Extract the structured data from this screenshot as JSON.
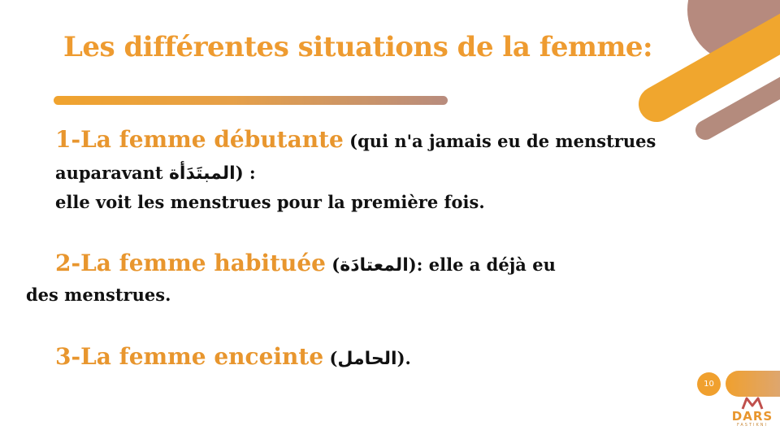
{
  "slide": {
    "title": "Les différentes situations de la femme:",
    "page_number": "10",
    "logo": {
      "text": "DARS",
      "subtext": "FASTIKNI"
    },
    "colors": {
      "accent": "#EE9B30",
      "secondary": "#B48B7D",
      "text": "#111111"
    }
  },
  "items": [
    {
      "lead": "1-La femme débutante",
      "line1_rest_open": " (qui n'a jamais eu de menstrues",
      "line2_start": "auparavant ",
      "arabic": "المبتَدَأة",
      "line2_end": ") :",
      "line3": "elle voit les menstrues pour la première fois."
    },
    {
      "lead": "2-La femme habituée",
      "open": " (",
      "arabic": "المعتادَة",
      "rest": "): elle a déjà eu",
      "line2": "des menstrues."
    },
    {
      "lead": "3-La femme enceinte",
      "open": " (",
      "arabic": "الحامل",
      "rest": ")."
    }
  ]
}
